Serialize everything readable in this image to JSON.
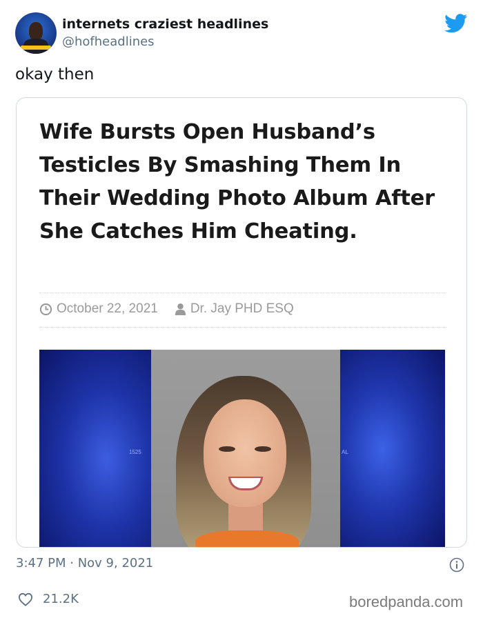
{
  "tweet": {
    "author_name": "internets craziest headlines",
    "author_handle": "@hofheadlines",
    "text": "okay then",
    "timestamp": "3:47 PM · Nov 9, 2021",
    "likes": "21.2K",
    "icons": {
      "brand": "twitter-bird-icon",
      "info": "info-icon",
      "like": "heart-icon"
    }
  },
  "card": {
    "headline": "Wife Bursts Open Husband’s Testicles By Smashing Them In Their Wedding Photo Album After She Catches Him Cheating.",
    "date": "October 22, 2021",
    "author": "Dr. Jay PHD ESQ",
    "icons": {
      "date": "clock-icon",
      "author": "user-icon"
    }
  },
  "image_labels": {
    "left_number": "1525",
    "right_text": "AL"
  },
  "watermark": "boredpanda.com",
  "colors": {
    "twitter_blue": "#1d9bf0",
    "secondary_text": "#5b7083",
    "border": "#cfd9de"
  }
}
